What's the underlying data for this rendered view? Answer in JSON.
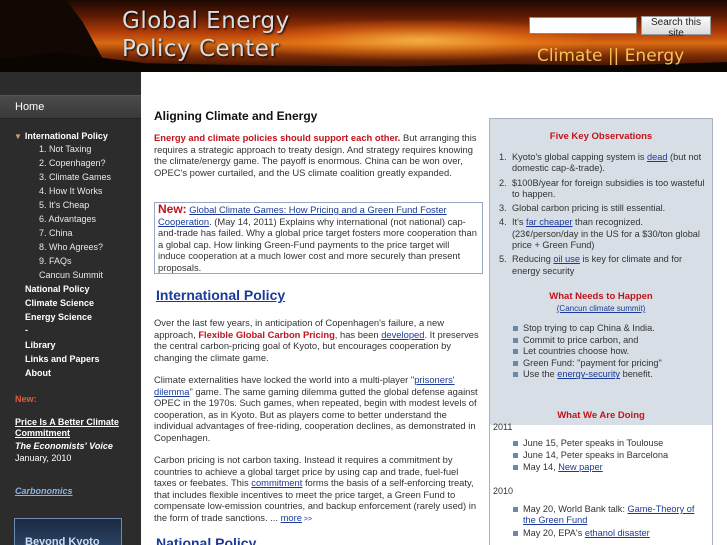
{
  "header": {
    "logo_line1": "Global Energy",
    "logo_line2": "Policy Center",
    "tagline": "Climate || Energy",
    "search_placeholder": "",
    "search_button": "Search this site"
  },
  "sidebar": {
    "home": "Home",
    "international_policy": "International Policy",
    "sub_items": [
      "1. Not Taxing",
      "2. Copenhagen?",
      "3. Climate Games",
      "4. How It Works",
      "5. It's Cheap",
      "6. Advantages",
      "7. China",
      "8. Who Agrees?",
      "9. FAQs",
      "Cancun Summit"
    ],
    "major_items": [
      "National Policy",
      "Climate Science",
      "Energy Science",
      "-",
      "Library",
      "Links and Papers",
      "About"
    ],
    "new_label": "New:",
    "feature_title": "Price Is A Better Climate Commitment",
    "feature_source": "The Economists' Voice",
    "feature_date": "January, 2010",
    "carbonomics": "Carbonomics",
    "book_text": "Beyond Kyoto"
  },
  "main": {
    "title": "Aligning Climate and Energy",
    "intro_bold": "Energy and climate policies should support each other.",
    "intro_rest": " But arranging this requires a strategic approach to treaty design. And strategy requires knowing the climate/energy game. The payoff is enormous. China can be won over, OPEC's power curtailed, and the US climate coalition greatly expanded.",
    "new_box": {
      "label": "New:",
      "link": "Global Climate Games: How Pricing and a Green Fund Foster Cooperation",
      "text": ". (May 14, 2011) Explains why international (not national) cap-and-trade has failed. Why a global price target fosters more cooperation than a global cap. How linking Green-Fund payments to the price target will induce cooperation at a much lower cost and more securely than present proposals."
    },
    "section1_heading": "International Policy",
    "s1_p1_a": "Over the last few years, in anticipation of Copenhagen's failure, a new approach, ",
    "s1_p1_bold": "Flexible Global Carbon Pricing",
    "s1_p1_b": ", has been ",
    "s1_p1_link": "developed",
    "s1_p1_c": ". It preserves the central carbon-pricing goal of Kyoto, but encourages cooperation by changing the climate game.",
    "s1_p2_a": "Climate externalities have locked the world into a multi-player \"",
    "s1_p2_link": "prisoners' dilemma",
    "s1_p2_b": "\" game. The same gaming dilemma gutted the global defense against OPEC in the 1970s. Such games, when repeated, begin with modest levels of cooperation, as in Kyoto. But as players come to better understand the individual advantages of free-riding, cooperation declines, as demonstrated in Copenhagen.",
    "s1_p3_a": "Carbon pricing is not carbon taxing. Instead it requires a commitment by countries to achieve a global target price by using cap and trade, fuel-fuel taxes or feebates. This ",
    "s1_p3_link": "commitment",
    "s1_p3_b": " forms the basis of a self-enforcing treaty, that includes flexible incentives to meet the price target, a Green Fund to compensate low-emission countries, and backup enforcement (rarely used) in the form of trade sanctions. ... ",
    "s1_p3_more": "more",
    "s1_p3_arrows": " >>",
    "section2_heading": "National Policy"
  },
  "right": {
    "obs_title": "Five Key Observations",
    "observations": [
      {
        "num": "1.",
        "pre": "Kyoto's global capping system is ",
        "link": "dead",
        "post": " (but not domestic cap-&-trade)."
      },
      {
        "num": "2.",
        "pre": "$100B/year for foreign subsidies is too wasteful to happen.",
        "link": "",
        "post": ""
      },
      {
        "num": "3.",
        "pre": "Global carbon pricing is still essential.",
        "link": "",
        "post": ""
      },
      {
        "num": "4.",
        "pre": "It's ",
        "link": "far cheaper",
        "post": " than recognized. (23¢/person/day in the US for a $30/ton global price + Green Fund)"
      },
      {
        "num": "5.",
        "pre": "Reducing ",
        "link": "oil use",
        "post": " is key for climate and for energy security"
      }
    ],
    "need_title": "What Needs to Happen",
    "need_sub": "(Cancun climate summit)",
    "needs": [
      {
        "pre": "Stop trying to cap China & India.",
        "link": "",
        "post": ""
      },
      {
        "pre": "Commit to price carbon, and",
        "link": "",
        "post": ""
      },
      {
        "pre": "Let countries choose how.",
        "link": "",
        "post": ""
      },
      {
        "pre": "Green Fund: \"payment for pricing\"",
        "link": "",
        "post": ""
      },
      {
        "pre": "Use the ",
        "link": "energy-security",
        "post": " benefit."
      }
    ],
    "doing_title": "What We Are Doing",
    "year_2011": "2011",
    "events_2011": [
      {
        "pre": "June 15, Peter speaks in Toulouse",
        "link": ""
      },
      {
        "pre": "June 14, Peter speaks in Barcelona",
        "link": ""
      },
      {
        "pre": "May 14, ",
        "link": "New paper"
      }
    ],
    "year_2010": "2010",
    "events_2010": [
      {
        "pre": "May 20, World Bank talk: ",
        "link": "Game-Theory of the Green Fund"
      },
      {
        "pre": "May 20, EPA's ",
        "link": "ethanol disaster"
      }
    ]
  }
}
